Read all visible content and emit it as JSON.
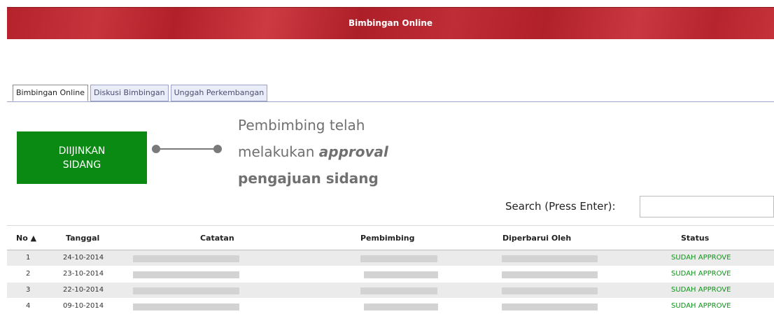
{
  "header": {
    "title": "Bimbingan Online",
    "accent": "#b5222c"
  },
  "tabs": [
    {
      "label": "Bimbingan Online",
      "active": true
    },
    {
      "label": "Diskusi Bimbingan",
      "active": false
    },
    {
      "label": "Unggah Perkembangan",
      "active": false
    }
  ],
  "status_box": {
    "line1": "DIIJINKAN",
    "line2": "SIDANG",
    "color": "#0a8a12"
  },
  "callout": {
    "line1": "Pembimbing telah",
    "line2_prefix": "melakukan ",
    "line2_emphasis": "approval",
    "line3": "pengajuan sidang"
  },
  "search": {
    "label": "Search (Press Enter):",
    "value": "",
    "placeholder": ""
  },
  "table": {
    "columns": [
      "No ▲",
      "Tanggal",
      "Catatan",
      "Pembimbing",
      "Diperbarui Oleh",
      "Status"
    ],
    "rows": [
      {
        "no": "1",
        "tanggal": "24-10-2014",
        "status": "SUDAH APPROVE"
      },
      {
        "no": "2",
        "tanggal": "23-10-2014",
        "status": "SUDAH APPROVE"
      },
      {
        "no": "3",
        "tanggal": "22-10-2014",
        "status": "SUDAH APPROVE"
      },
      {
        "no": "4",
        "tanggal": "09-10-2014",
        "status": "SUDAH APPROVE"
      }
    ],
    "status_color": "#11931b"
  }
}
